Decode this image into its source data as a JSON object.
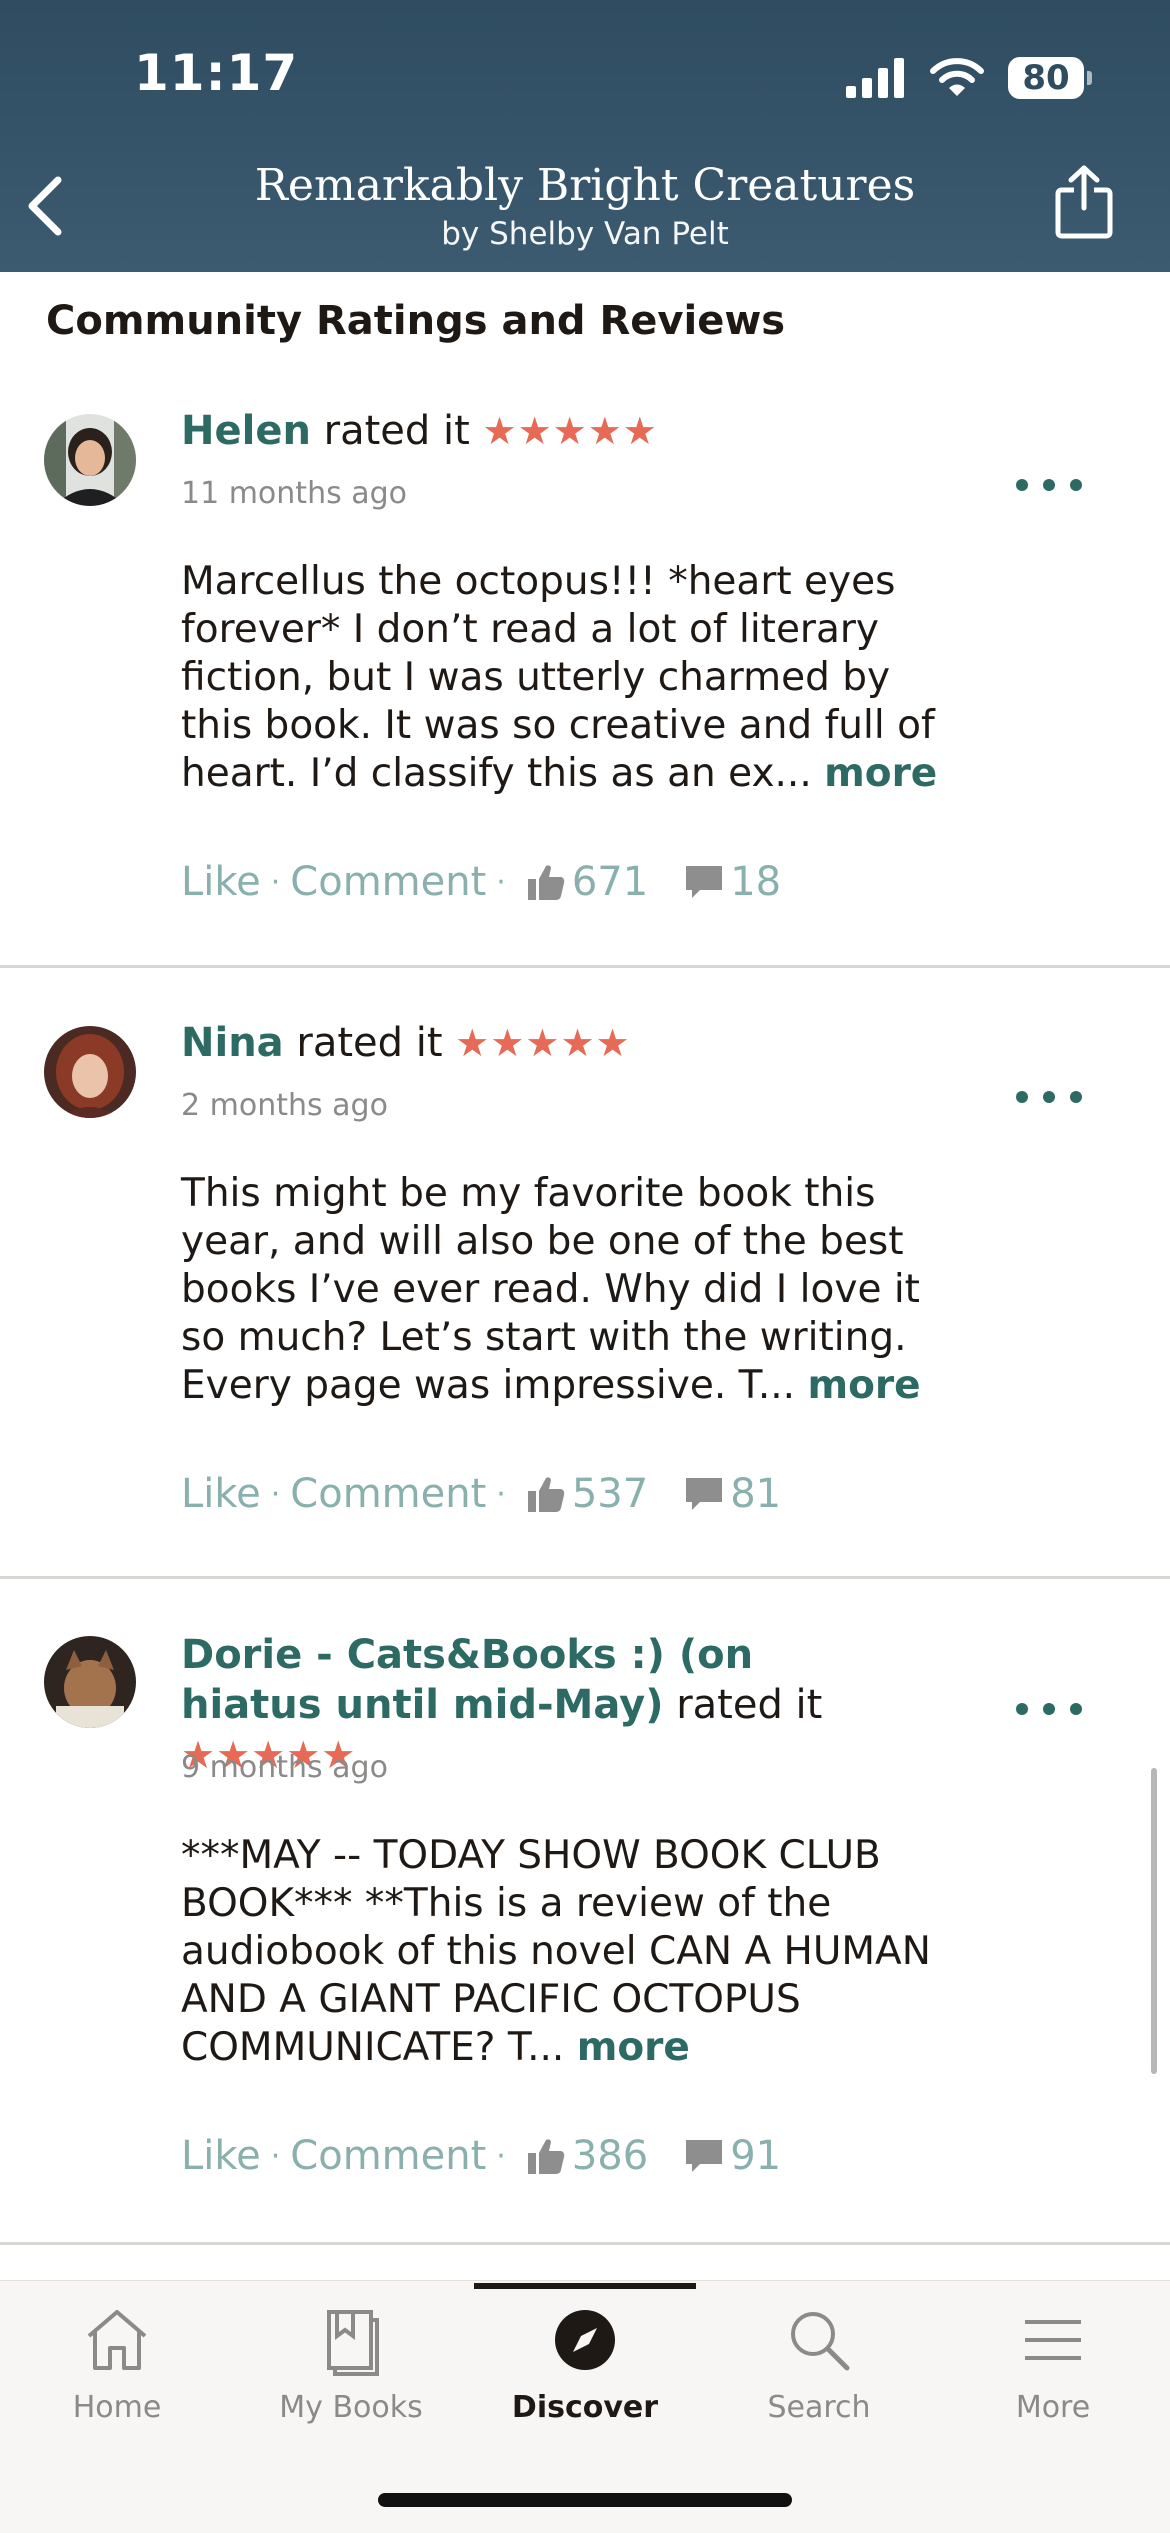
{
  "status": {
    "time": "11:17",
    "battery": "80"
  },
  "header": {
    "title": "Remarkably Bright Creatures",
    "author": "by Shelby Van Pelt"
  },
  "section_title": "Community Ratings and Reviews",
  "labels": {
    "rated": "rated it",
    "more": "more",
    "like": "Like",
    "comment": "Comment",
    "dot": "·"
  },
  "reviews": [
    {
      "name": "Helen",
      "stars": "★★★★★",
      "time": "11 months ago",
      "text": "Marcellus the octopus!!! *heart eyes forever*  I don’t read a lot of literary fiction, but I was utterly charmed by this book. It was so creative and full of heart. I’d classify this as an ex...",
      "likes": "671",
      "comments": "18"
    },
    {
      "name": "Nina",
      "stars": "★★★★★",
      "time": "2 months ago",
      "text": "This might be my favorite book this year, and will also be one of the best books I’ve ever read. Why did I love it so much?   Let’s start with the writing. Every page was impressive. T...",
      "likes": "537",
      "comments": "81"
    },
    {
      "name": "Dorie  - Cats&Books :) (on hiatus until mid-May)",
      "stars": "★★★★★",
      "time": "9 months ago",
      "text": "***MAY -- TODAY SHOW BOOK CLUB BOOK***  **This is a review of the audiobook of this novel  CAN A HUMAN AND A GIANT PACIFIC OCTOPUS COMMUNICATE?  T...",
      "likes": "386",
      "comments": "91"
    }
  ],
  "tabs": [
    {
      "label": "Home",
      "icon": "home-icon"
    },
    {
      "label": "My Books",
      "icon": "my-books-icon"
    },
    {
      "label": "Discover",
      "icon": "discover-compass-icon",
      "active": true
    },
    {
      "label": "Search",
      "icon": "search-icon"
    },
    {
      "label": "More",
      "icon": "hamburger-menu-icon"
    }
  ],
  "colors": {
    "header": "#2f4c61",
    "accent": "#2c6a63",
    "star": "#e66a55",
    "muted": "#8ab0ad"
  }
}
